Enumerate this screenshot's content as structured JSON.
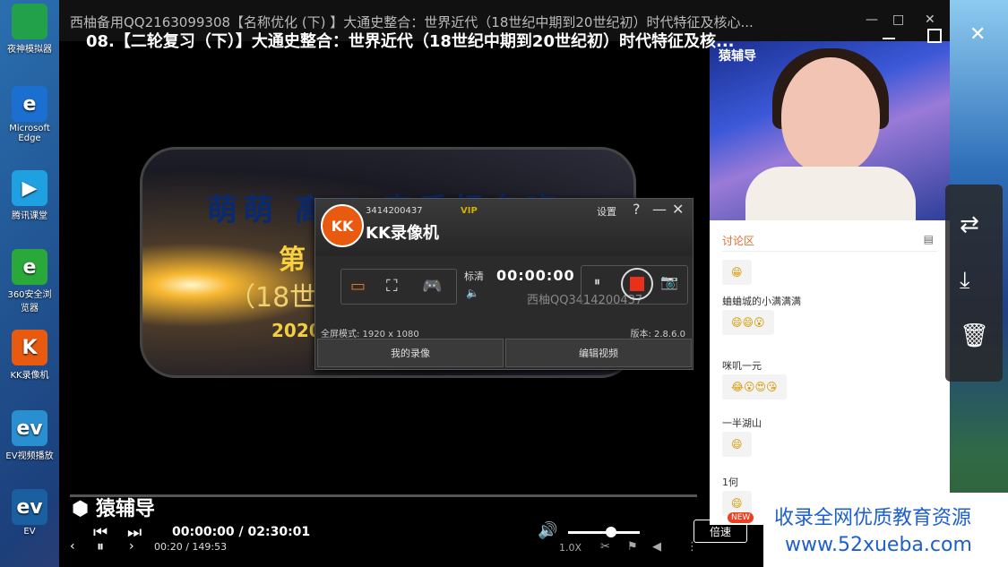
{
  "desktop": {
    "icons": [
      {
        "label": "夜神模拟器",
        "color": "#22a04a",
        "glyph": ""
      },
      {
        "label": "Microsoft Edge",
        "color": "#1a6fd0",
        "glyph": "e"
      },
      {
        "label": "腾讯课堂",
        "color": "#1fa0e0",
        "glyph": "▶"
      },
      {
        "label": "360安全浏览器",
        "color": "#2aa83a",
        "glyph": "e"
      },
      {
        "label": "KK录像机",
        "color": "#e85a10",
        "glyph": "K"
      },
      {
        "label": "EV视频播放",
        "color": "#2a8fd0",
        "glyph": "ev"
      },
      {
        "label": "EV",
        "color": "#1a5fa0",
        "glyph": "ev"
      }
    ]
  },
  "player": {
    "title_sub": "西柚备用QQ2163099308【名称优化 (下) 】大通史整合：世界近代（18世纪中期到20世纪初）时代特征及核心...",
    "title_main": "08.【二轮复习（下）】大通史整合：世界近代（18世纪中期到20世纪初）时代特征及核...",
    "slide": {
      "line1": "萌萌 高三 春季报名班",
      "line2": "第",
      "line3": "（18世纪",
      "line4": "2020"
    },
    "webcam_logo": "猿辅导",
    "brand": "猿辅导",
    "time_main": "00:00:00 / 02:30:01",
    "time_sub": "00:20 / 149:53",
    "speed_label": "倍速",
    "speed_badge": "NEW",
    "rate": "1.0X"
  },
  "chat": {
    "tab": "讨论区",
    "messages": [
      {
        "name": "",
        "emoji": "😁"
      },
      {
        "name": "蛐蛐城的小满满满",
        "emoji": "😄😄😮"
      },
      {
        "name": "咪叽一元",
        "emoji": "😂😮😍😘"
      },
      {
        "name": "一半湖山",
        "emoji": "😄"
      },
      {
        "name": "1何",
        "emoji": "😄"
      }
    ]
  },
  "kk": {
    "account": "3414200437",
    "vip": "VIP",
    "name": "KK录像机",
    "settings": "设置",
    "quality": "标清",
    "timer": "00:00:00",
    "watermark": "西柚QQ3414200437",
    "mode_info": "全屏模式: 1920 x 1080",
    "version": "版本: 2.8.6.0",
    "btn_records": "我的录像",
    "btn_edit": "编辑视频"
  },
  "promo": {
    "line1": "收录全网优质教育资源",
    "line2": "www.52xueba.com"
  }
}
